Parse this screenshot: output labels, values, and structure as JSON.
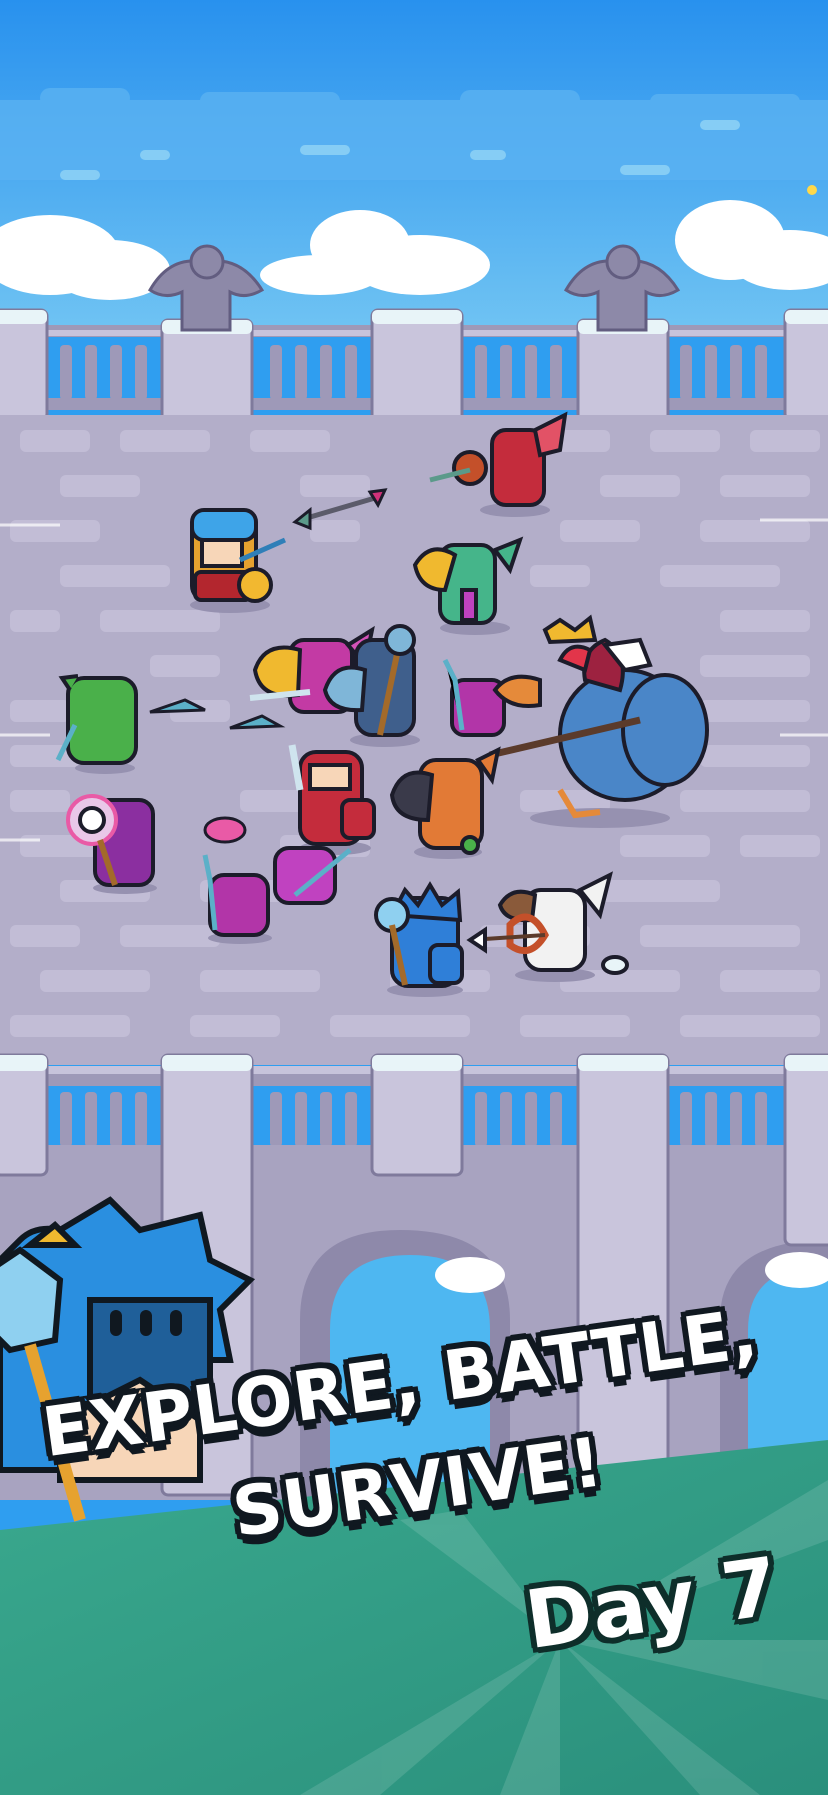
{
  "scene": {
    "sky_color": "#2f9ef0",
    "bridge_stone_color": "#b3aec9",
    "banner_color": "#2f9c86"
  },
  "promo": {
    "headline_line1": "EXPLORE, BATTLE,",
    "headline_line2": "SURVIVE!",
    "day_label": "Day 7"
  },
  "characters": [
    "player-knight",
    "red-parrot-enemy",
    "green-parrot-enemy",
    "yellow-beak-bird-enemy",
    "blue-bird-staff-enemy",
    "purple-spear-imp",
    "giant-vulture-boss",
    "green-goblin-ally",
    "skull-mage-ally",
    "red-shield-knight-ally",
    "orange-toucan-enemy",
    "purple-imp-spear",
    "pink-hood-imp",
    "blue-spiked-knight-ally",
    "white-eagle-archer-enemy",
    "spiked-knight-hero-portrait"
  ]
}
